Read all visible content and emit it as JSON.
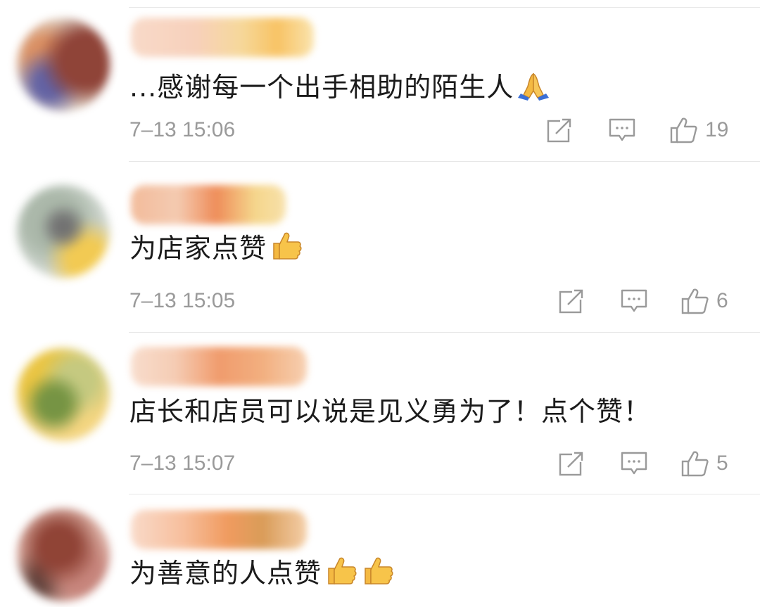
{
  "comments": [
    {
      "text": "...感谢每一个出手相助的陌生人",
      "emoji": "folded-hands",
      "timestamp": "7–13 15:06",
      "likes": "19",
      "avatar_colors": [
        "#8a3a2e",
        "#c98e6a",
        "#5a5aa0",
        "#d9c7b8"
      ],
      "name_colors": [
        "#f6c9b0",
        "#f5d28a",
        "#f7b94a"
      ]
    },
    {
      "text": "为店家点赞",
      "emoji": "thumbs-up",
      "timestamp": "7–13 15:05",
      "likes": "6",
      "avatar_colors": [
        "#a7b5a6",
        "#6b6b6b",
        "#f2c84a",
        "#cfd6cf"
      ],
      "name_colors": [
        "#f0b08a",
        "#ec7a3e",
        "#f4cf78"
      ]
    },
    {
      "text": "店长和店员可以说是见义勇为了！点个赞！",
      "emoji": "",
      "timestamp": "7–13 15:07",
      "likes": "5",
      "avatar_colors": [
        "#e9c23a",
        "#6f8f3a",
        "#f3d37a",
        "#c2c77a"
      ],
      "name_colors": [
        "#f4c4a8",
        "#ee8b54",
        "#f0a26a"
      ]
    },
    {
      "text": "为善意的人点赞",
      "emoji": "thumbs-up-double",
      "timestamp": "",
      "likes": "",
      "avatar_colors": [
        "#8b3a2c",
        "#d7a69a",
        "#5b3b34",
        "#c47f75"
      ],
      "name_colors": [
        "#f6b48c",
        "#ee8a44",
        "#d38b3c"
      ]
    }
  ]
}
